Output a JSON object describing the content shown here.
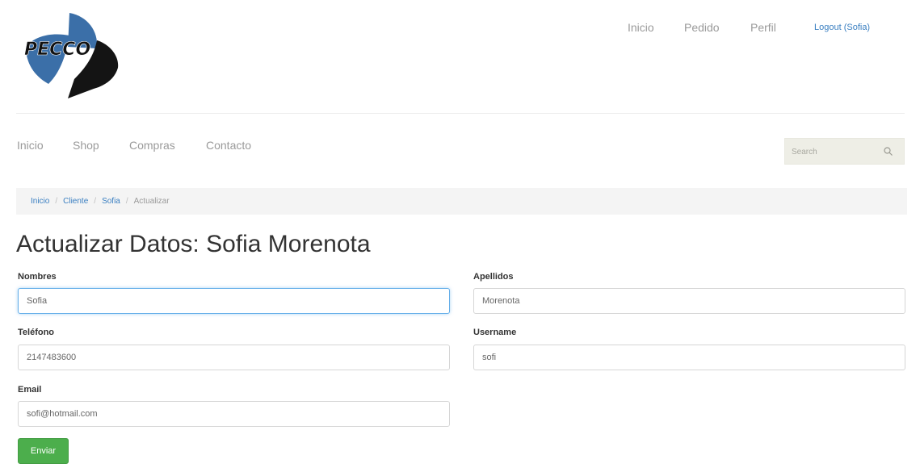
{
  "brand": {
    "logo_text": "PECCO",
    "colors": {
      "logo_blue": "#3b6fa8",
      "logo_dark": "#111111"
    }
  },
  "top_nav": {
    "items": [
      {
        "label": "Inicio"
      },
      {
        "label": "Pedido"
      },
      {
        "label": "Perfil"
      }
    ],
    "logout": "Logout (Sofia)"
  },
  "main_nav": {
    "items": [
      {
        "label": "Inicio"
      },
      {
        "label": "Shop"
      },
      {
        "label": "Compras"
      },
      {
        "label": "Contacto"
      }
    ]
  },
  "search": {
    "placeholder": "Search",
    "icon": "search-icon"
  },
  "breadcrumb": {
    "items": [
      {
        "label": "Inicio"
      },
      {
        "label": "Cliente"
      },
      {
        "label": "Sofia"
      }
    ],
    "current": "Actualizar",
    "separator": "/"
  },
  "page": {
    "title": "Actualizar Datos: Sofia Morenota"
  },
  "form": {
    "nombres": {
      "label": "Nombres",
      "value": "Sofia"
    },
    "apellidos": {
      "label": "Apellidos",
      "value": "Morenota"
    },
    "telefono": {
      "label": "Teléfono",
      "value": "2147483600"
    },
    "username": {
      "label": "Username",
      "value": "sofi"
    },
    "email": {
      "label": "Email",
      "value": "sofi@hotmail.com"
    },
    "submit": "Enviar"
  },
  "colors": {
    "link": "#3a7fc1",
    "submit": "#4cae4c",
    "focus": "#66afe9"
  }
}
